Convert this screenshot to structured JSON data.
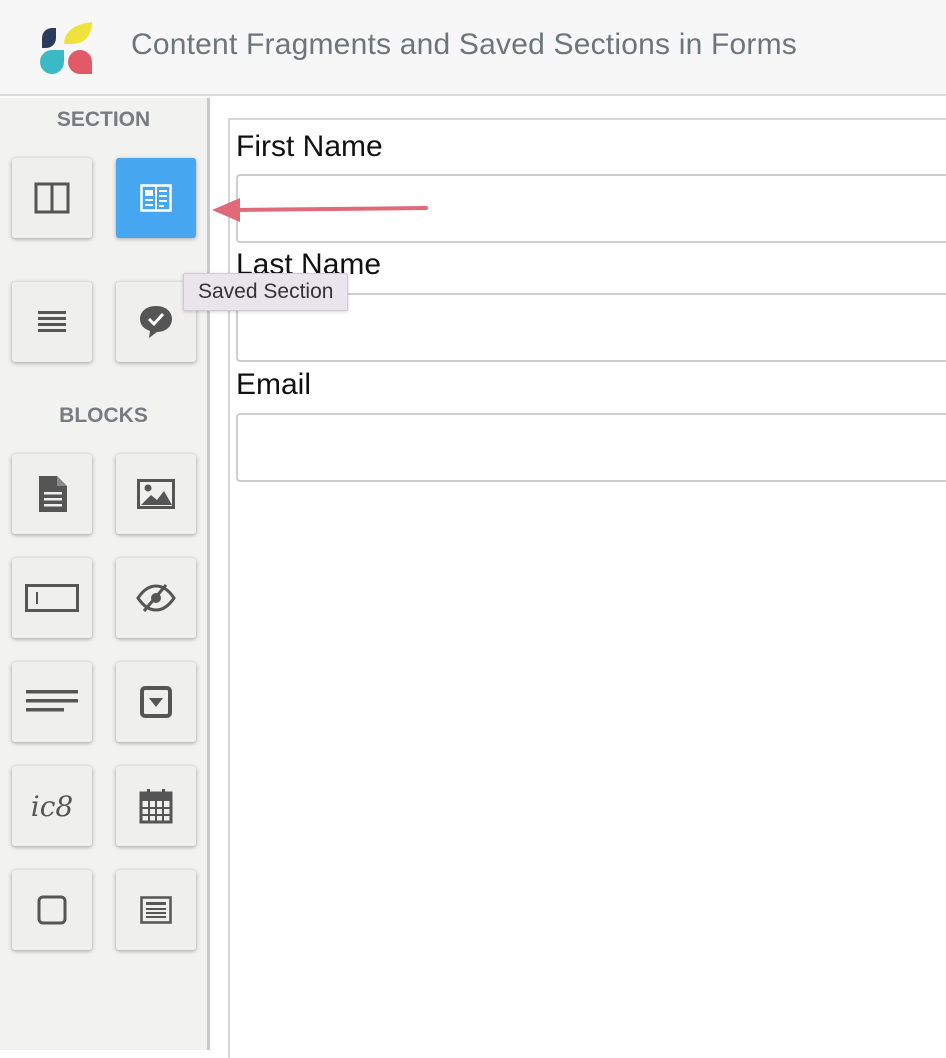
{
  "header": {
    "title": "Content Fragments and Saved Sections in Forms",
    "logo_colors": [
      "#f0e23e",
      "#2b3b5b",
      "#3bb9c4",
      "#e25a68"
    ]
  },
  "sidebar": {
    "section_heading": "SECTION",
    "blocks_heading": "BLOCKS",
    "section_tiles": [
      {
        "icon": "columns-icon",
        "active": false
      },
      {
        "icon": "saved-section-icon",
        "active": true
      },
      {
        "icon": "list-lines-icon",
        "active": false
      },
      {
        "icon": "chat-check-icon",
        "active": false
      }
    ],
    "block_tiles": [
      {
        "icon": "document-icon"
      },
      {
        "icon": "image-icon"
      },
      {
        "icon": "text-input-icon"
      },
      {
        "icon": "hidden-eye-icon"
      },
      {
        "icon": "paragraph-icon"
      },
      {
        "icon": "dropdown-icon"
      },
      {
        "icon": "captcha-icon"
      },
      {
        "icon": "calendar-icon"
      },
      {
        "icon": "checkbox-icon"
      },
      {
        "icon": "form-box-icon"
      }
    ],
    "accent_color": "#47a6f0"
  },
  "tooltip": {
    "text": "Saved Section"
  },
  "form": {
    "fields": [
      {
        "label": "First Name",
        "value": "",
        "placeholder": ""
      },
      {
        "label": "Last Name",
        "value": "",
        "placeholder": ""
      },
      {
        "label": "Email",
        "value": "",
        "placeholder": ""
      }
    ]
  },
  "captcha_glyph": "ic8",
  "arrow_color": "#e0697a"
}
